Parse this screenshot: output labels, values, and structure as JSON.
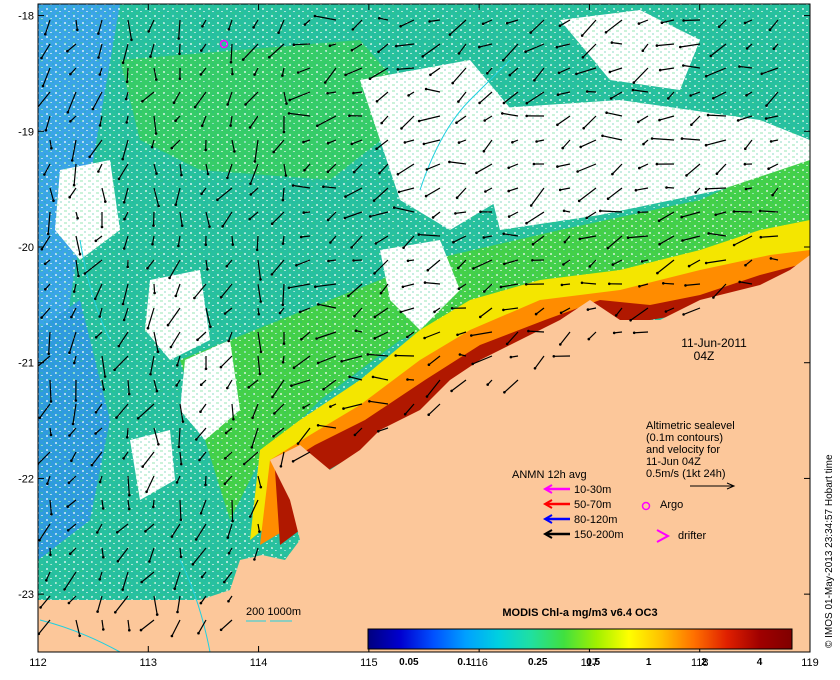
{
  "map": {
    "x_ticks": [
      "112",
      "113",
      "114",
      "115",
      "116",
      "117",
      "118",
      "119"
    ],
    "y_ticks": [
      "-18",
      "-19",
      "-20",
      "-21",
      "-22",
      "-23"
    ],
    "lon_range": [
      112,
      119
    ],
    "lat_range": [
      -23.5,
      -17.9
    ]
  },
  "timestamp": {
    "date": "11-Jun-2011",
    "hour": "04Z"
  },
  "altimetry_note": {
    "lines": [
      "Altimetric sealevel",
      "(0.1m contours)",
      "and velocity for",
      "11-Jun 04Z",
      "0.5m/s (1kt 24h)"
    ]
  },
  "anmn_legend": {
    "title": "ANMN 12h avg",
    "items": [
      {
        "label": "10-30m",
        "color": "#ff00ff"
      },
      {
        "label": "50-70m",
        "color": "#ff0000"
      },
      {
        "label": "80-120m",
        "color": "#0000ff"
      },
      {
        "label": "150-200m",
        "color": "#000000"
      }
    ]
  },
  "markers": {
    "argo_label": "Argo",
    "drifter_label": "drifter",
    "argo_color": "#ff00ff",
    "drifter_color": "#ff00ff"
  },
  "depth_legend": {
    "label": "200  1000m"
  },
  "colorbar": {
    "title": "MODIS Chl-a mg/m3 v6.4 OC3",
    "tick_labels": [
      "0.05",
      "0.1",
      "0.25",
      "0.5",
      "1",
      "2",
      "4"
    ],
    "stops": [
      "#00007f",
      "#0000d0",
      "#0050ff",
      "#00a0ff",
      "#00d0e0",
      "#20e0a0",
      "#40e040",
      "#a0f000",
      "#ffff00",
      "#ffc000",
      "#ff7000",
      "#e02000",
      "#a00000",
      "#800000"
    ]
  },
  "credit": "© IMOS 01-May-2013 23:34:57 Hobart time",
  "colors": {
    "land": "#fcc79a",
    "cloud": "#ffffff",
    "ocean_blue": "#3ca0e6",
    "ocean_teal": "#20c0a0",
    "ocean_green": "#40d060",
    "chl_yellow": "#f0e000",
    "chl_orange": "#ff8000",
    "chl_red": "#c02000",
    "chl_dark": "#800000"
  }
}
